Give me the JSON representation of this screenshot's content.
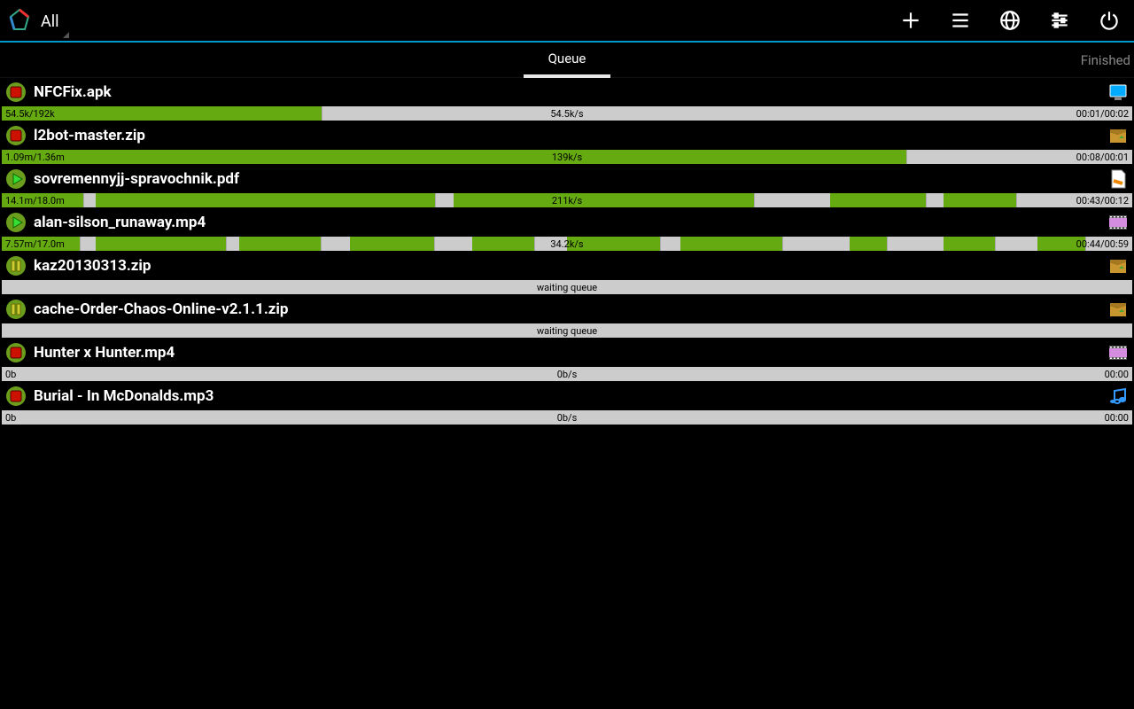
{
  "header": {
    "filter_label": "All"
  },
  "tabs": {
    "queue": "Queue",
    "finished": "Finished"
  },
  "items": [
    {
      "state": "stop",
      "name": "NFCFix.apk",
      "ftype": "apk",
      "size": "54.5k/192k",
      "speed": "54.5k/s",
      "time": "00:01/00:02",
      "segments": [
        [
          0,
          28.4
        ]
      ]
    },
    {
      "state": "stop",
      "name": "l2bot-master.zip",
      "ftype": "zip",
      "size": "1.09m/1.36m",
      "speed": "139k/s",
      "time": "00:08/00:01",
      "segments": [
        [
          0,
          80.1
        ]
      ]
    },
    {
      "state": "play",
      "name": "sovremennyjj-spravochnik.pdf",
      "ftype": "pdf",
      "size": "14.1m/18.0m",
      "speed": "211k/s",
      "time": "00:43/00:12",
      "segments": [
        [
          0,
          7.3
        ],
        [
          8.3,
          30.1
        ],
        [
          40,
          26.6
        ],
        [
          73.3,
          8.5
        ],
        [
          83.3,
          6.5
        ]
      ]
    },
    {
      "state": "play",
      "name": "alan-silson_runaway.mp4",
      "ftype": "video",
      "size": "7.57m/17.0m",
      "speed": "34.2k/s",
      "time": "00:44/00:59",
      "segments": [
        [
          0,
          7.0
        ],
        [
          8.3,
          11.6
        ],
        [
          21.0,
          7.3
        ],
        [
          30.8,
          7.5
        ],
        [
          41.6,
          5.6
        ],
        [
          50.0,
          8.3
        ],
        [
          60.0,
          9.1
        ],
        [
          75.0,
          3.4
        ],
        [
          83.3,
          4.6
        ],
        [
          91.6,
          4.3
        ]
      ]
    },
    {
      "state": "pause",
      "name": "kaz20130313.zip",
      "ftype": "zip",
      "waiting": "waiting queue"
    },
    {
      "state": "pause",
      "name": "cache-Order-Chaos-Online-v2.1.1.zip",
      "ftype": "zip",
      "waiting": "waiting queue"
    },
    {
      "state": "stop",
      "name": "Hunter x Hunter.mp4",
      "ftype": "video",
      "size": "0b",
      "speed": "0b/s",
      "time": "00:00",
      "segments": []
    },
    {
      "state": "stop",
      "name": "Burial - In McDonalds.mp3",
      "ftype": "audio",
      "size": "0b",
      "speed": "0b/s",
      "time": "00:00",
      "segments": []
    }
  ]
}
